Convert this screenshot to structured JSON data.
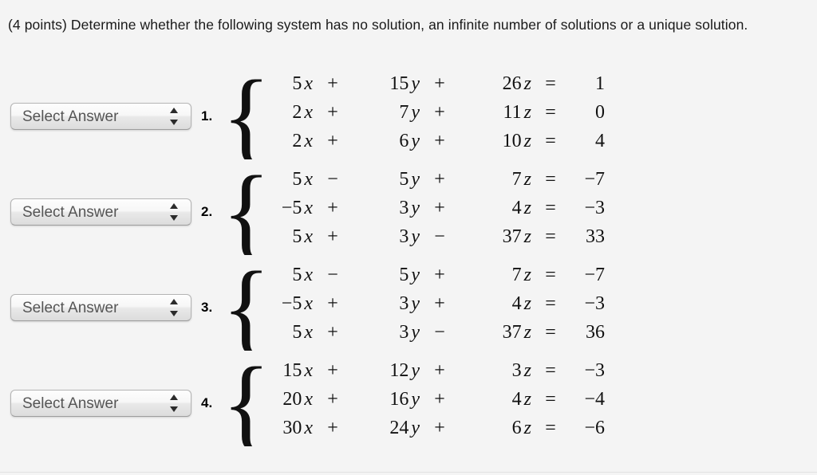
{
  "page": {
    "background_color": "#f4f4f4",
    "prompt": "(4 points) Determine whether the following system has no solution, an infinite number of solutions or a unique solution."
  },
  "select": {
    "label": "Select Answer",
    "stepper_up_icon": "triangle-up-icon",
    "stepper_down_icon": "triangle-down-icon"
  },
  "problems": [
    {
      "index": "1.",
      "equations": [
        {
          "c1": "5",
          "v1": "x",
          "op1": "+",
          "c2": "15",
          "v2": "y",
          "op2": "+",
          "c3": "26",
          "v3": "z",
          "eq": "=",
          "rhs": "1"
        },
        {
          "c1": "2",
          "v1": "x",
          "op1": "+",
          "c2": "7",
          "v2": "y",
          "op2": "+",
          "c3": "11",
          "v3": "z",
          "eq": "=",
          "rhs": "0"
        },
        {
          "c1": "2",
          "v1": "x",
          "op1": "+",
          "c2": "6",
          "v2": "y",
          "op2": "+",
          "c3": "10",
          "v3": "z",
          "eq": "=",
          "rhs": "4"
        }
      ]
    },
    {
      "index": "2.",
      "equations": [
        {
          "c1": "5",
          "v1": "x",
          "op1": "−",
          "c2": "5",
          "v2": "y",
          "op2": "+",
          "c3": "7",
          "v3": "z",
          "eq": "=",
          "rhs": "−7"
        },
        {
          "c1": "−5",
          "v1": "x",
          "op1": "+",
          "c2": "3",
          "v2": "y",
          "op2": "+",
          "c3": "4",
          "v3": "z",
          "eq": "=",
          "rhs": "−3"
        },
        {
          "c1": "5",
          "v1": "x",
          "op1": "+",
          "c2": "3",
          "v2": "y",
          "op2": "−",
          "c3": "37",
          "v3": "z",
          "eq": "=",
          "rhs": "33"
        }
      ]
    },
    {
      "index": "3.",
      "equations": [
        {
          "c1": "5",
          "v1": "x",
          "op1": "−",
          "c2": "5",
          "v2": "y",
          "op2": "+",
          "c3": "7",
          "v3": "z",
          "eq": "=",
          "rhs": "−7"
        },
        {
          "c1": "−5",
          "v1": "x",
          "op1": "+",
          "c2": "3",
          "v2": "y",
          "op2": "+",
          "c3": "4",
          "v3": "z",
          "eq": "=",
          "rhs": "−3"
        },
        {
          "c1": "5",
          "v1": "x",
          "op1": "+",
          "c2": "3",
          "v2": "y",
          "op2": "−",
          "c3": "37",
          "v3": "z",
          "eq": "=",
          "rhs": "36"
        }
      ]
    },
    {
      "index": "4.",
      "equations": [
        {
          "c1": "15",
          "v1": "x",
          "op1": "+",
          "c2": "12",
          "v2": "y",
          "op2": "+",
          "c3": "3",
          "v3": "z",
          "eq": "=",
          "rhs": "−3"
        },
        {
          "c1": "20",
          "v1": "x",
          "op1": "+",
          "c2": "16",
          "v2": "y",
          "op2": "+",
          "c3": "4",
          "v3": "z",
          "eq": "=",
          "rhs": "−4"
        },
        {
          "c1": "30",
          "v1": "x",
          "op1": "+",
          "c2": "24",
          "v2": "y",
          "op2": "+",
          "c3": "6",
          "v3": "z",
          "eq": "=",
          "rhs": "−6"
        }
      ]
    }
  ],
  "brace_glyph": "{"
}
